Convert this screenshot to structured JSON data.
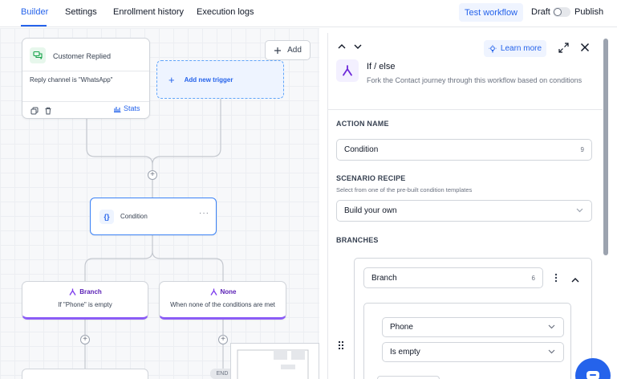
{
  "topbar": {
    "tabs": [
      "Builder",
      "Settings",
      "Enrollment history",
      "Execution logs"
    ],
    "test_workflow": "Test workflow",
    "draft": "Draft",
    "publish": "Publish",
    "accent": "#2563eb"
  },
  "canvas": {
    "add_label": "Add",
    "trigger": {
      "title": "Customer Replied",
      "subtitle": "Reply channel is \"WhatsApp\"",
      "stats": "Stats",
      "icon": "chat-bubbles-icon"
    },
    "add_new_trigger": "Add new trigger",
    "condition": {
      "icon_glyph": "{}",
      "label": "Condition",
      "more": "···"
    },
    "branches": [
      {
        "title": "Branch",
        "description": "If \"Phone\" is empty"
      },
      {
        "title": "None",
        "description": "When none of the conditions are met"
      }
    ],
    "end_label": "END",
    "plus": "+"
  },
  "panel": {
    "learn_more": "Learn more",
    "action_title": "If / else",
    "action_description": "Fork the Contact journey through this workflow based on conditions",
    "action_name_label": "ACTION NAME",
    "action_name_value": "Condition",
    "action_name_count": "9",
    "scenario_label": "SCENARIO RECIPE",
    "scenario_helper": "Select from one of the pre-built condition templates",
    "scenario_value": "Build your own",
    "branches_label": "BRANCHES",
    "branch_name_value": "Branch",
    "branch_name_count": "6",
    "field_value": "Phone",
    "operator_value": "Is empty",
    "branch_color": "#8b5cf6"
  }
}
